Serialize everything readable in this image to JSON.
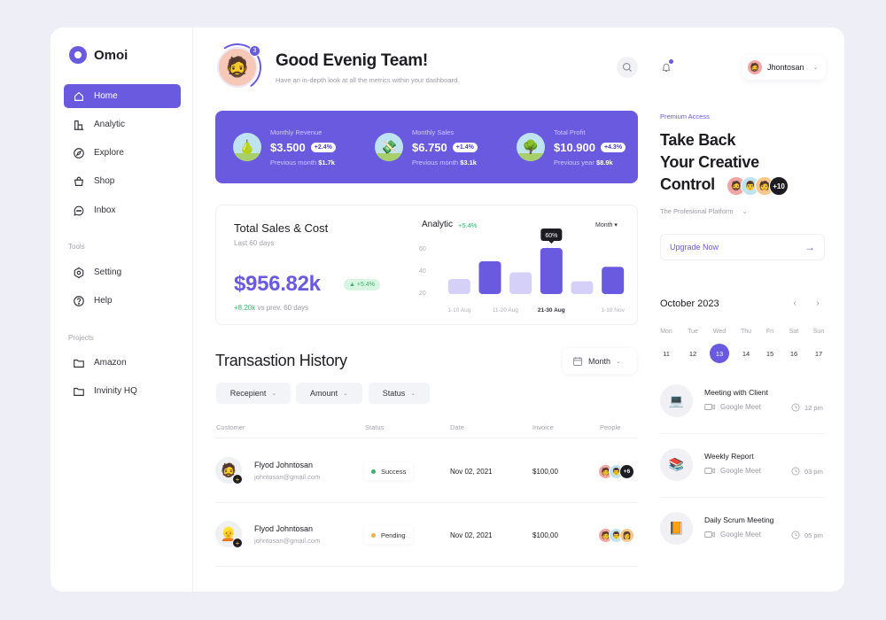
{
  "app": {
    "name": "Omoi",
    "brand_color": "#6a5ae0"
  },
  "sidebar": {
    "main_items": [
      {
        "label": "Home",
        "icon": "home-icon",
        "active": true
      },
      {
        "label": "Analytic",
        "icon": "analytic-icon",
        "active": false
      },
      {
        "label": "Explore",
        "icon": "compass-icon",
        "active": false
      },
      {
        "label": "Shop",
        "icon": "bag-icon",
        "active": false
      },
      {
        "label": "Inbox",
        "icon": "chat-icon",
        "active": false
      }
    ],
    "tools_label": "Tools",
    "tools_items": [
      {
        "label": "Setting",
        "icon": "gear-icon"
      },
      {
        "label": "Help",
        "icon": "help-icon"
      }
    ],
    "projects_label": "Projects",
    "projects_items": [
      {
        "label": "Amazon",
        "icon": "folder-icon"
      },
      {
        "label": "Invinity HQ",
        "icon": "folder-icon"
      }
    ]
  },
  "header": {
    "notification_count": "3",
    "greeting": "Good Evenig Team!",
    "subtitle": "Have an in-depth look at all the metrics within your dashboard.",
    "user_name": "Jhontosan"
  },
  "stats": [
    {
      "label": "Monthly Revenue",
      "value": "$3.500",
      "change": "+2.4%",
      "prev_label": "Previous month",
      "prev_value": "$1.7k",
      "emoji": "🍐"
    },
    {
      "label": "Monthly Sales",
      "value": "$6.750",
      "change": "+1.4%",
      "prev_label": "Previous month",
      "prev_value": "$3.1k",
      "emoji": "💸"
    },
    {
      "label": "Total Profit",
      "value": "$10.900",
      "change": "+4.3%",
      "prev_label": "Previous year",
      "prev_value": "$8.9k",
      "emoji": "🌳"
    }
  ],
  "sales": {
    "title": "Total Sales & Cost",
    "period": "Last 60 days",
    "value": "$956.82k",
    "change": "▲ +5.4%",
    "delta": "+8.20k",
    "delta_suffix": "vs prev. 60 days"
  },
  "analytic": {
    "title": "Analytic",
    "change": "+5.4%",
    "period_select": "Month ▾"
  },
  "chart_data": {
    "type": "bar",
    "title": "Analytic",
    "categories": [
      "1-10 Aug",
      "",
      "11-20 Aug",
      "21-30 Aug",
      "",
      "1-10 Nov"
    ],
    "x_tick_labels": [
      "1-10 Aug",
      "11-20 Aug",
      "21-30 Aug",
      "1-10 Nov"
    ],
    "values": [
      32,
      48,
      38,
      60,
      30,
      43
    ],
    "highlight": [
      false,
      true,
      false,
      true,
      false,
      true
    ],
    "colors": {
      "highlight": "#6a5ae0",
      "muted": "#d4d0f7"
    },
    "yticks": [
      20,
      40,
      60
    ],
    "ylim": [
      20,
      60
    ],
    "tooltip": {
      "index": 3,
      "text": "60%"
    },
    "active_tick": "21-30 Aug"
  },
  "transactions": {
    "title": "Transastion History",
    "period_button": "Month",
    "filters": [
      "Recepient",
      "Amount",
      "Status"
    ],
    "columns": [
      "Customer",
      "Status",
      "Date",
      "Invoice",
      "People"
    ],
    "rows": [
      {
        "name": "Flyod Johntosan",
        "email": "johntosan@gmail.com",
        "status": "Success",
        "status_color": "#3bb26b",
        "date": "Nov 02, 2021",
        "invoice": "$100,00",
        "avatar": "🧔",
        "people": [
          "🧑",
          "👨"
        ],
        "people_more": "+6"
      },
      {
        "name": "Flyod Johntosan",
        "email": "johntosan@gmail.com",
        "status": "Pending",
        "status_color": "#f0b24a",
        "date": "Nov 02, 2021",
        "invoice": "$100,00",
        "avatar": "👱",
        "people": [
          "🧑",
          "👨",
          "👩"
        ],
        "people_more": ""
      }
    ]
  },
  "promo": {
    "eyebrow": "Premium Access",
    "title_line1": "Take Back",
    "title_line2": "Your Creative",
    "title_line3": "Control",
    "avatars_more": "+10",
    "platform": "The Profesional Platform",
    "cta": "Upgrade Now"
  },
  "calendar": {
    "month": "October 2023",
    "weekdays": [
      "Mon",
      "Tue",
      "Wed",
      "Thu",
      "Fri",
      "Sat",
      "Sun"
    ],
    "days": [
      "11",
      "12",
      "13",
      "14",
      "15",
      "16",
      "17"
    ],
    "selected": "13"
  },
  "events": [
    {
      "title": "Meeting with Client",
      "platform": "Google Meet",
      "time": "12 pm",
      "emoji": "💻"
    },
    {
      "title": "Weekly Report",
      "platform": "Google Meet",
      "time": "03 pm",
      "emoji": "📚"
    },
    {
      "title": "Daily Scrum Meeting",
      "platform": "Google Meet",
      "time": "05 pm",
      "emoji": "📙"
    }
  ]
}
